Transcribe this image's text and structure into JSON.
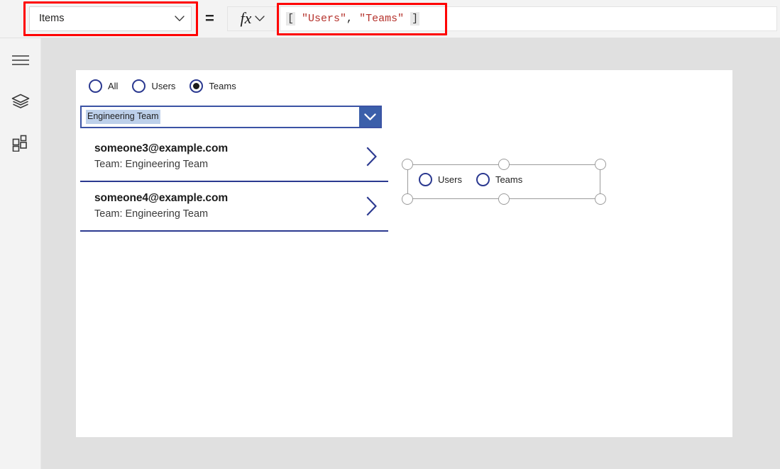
{
  "topbar": {
    "property_dropdown": {
      "value": "Items",
      "icon": "chevron-down-icon"
    },
    "equals": "=",
    "fx_button": {
      "glyph": "fx",
      "icon": "chevron-down-icon"
    },
    "formula": {
      "full_text": "[ \"Users\", \"Teams\" ]",
      "open_bracket": "[",
      "close_bracket": "]",
      "space_lead": " ",
      "space_trail": " ",
      "str_users": "\"Users\"",
      "comma": ", ",
      "str_teams": "\"Teams\""
    },
    "annotations": [
      {
        "name": "property-dropdown-highlight",
        "color": "#ff0000"
      },
      {
        "name": "formula-bar-highlight",
        "color": "#ff0000"
      }
    ]
  },
  "rail": {
    "items": [
      {
        "name": "hamburger-menu-icon",
        "label": "Menu"
      },
      {
        "name": "tree-view-icon",
        "label": "Tree view"
      },
      {
        "name": "insert-icon",
        "label": "Insert"
      }
    ]
  },
  "canvas": {
    "radio_group": {
      "name": "radio-group-filter",
      "options": [
        {
          "label": "All",
          "selected": false
        },
        {
          "label": "Users",
          "selected": false
        },
        {
          "label": "Teams",
          "selected": true
        }
      ]
    },
    "combobox": {
      "name": "team-combobox",
      "value": "Engineering Team",
      "icon": "chevron-down-icon"
    },
    "gallery": {
      "name": "member-gallery",
      "items": [
        {
          "title": "someone3@example.com",
          "subtitle": "Team: Engineering Team",
          "icon": "chevron-right-icon"
        },
        {
          "title": "someone4@example.com",
          "subtitle": "Team: Engineering Team",
          "icon": "chevron-right-icon"
        }
      ]
    },
    "selected_control": {
      "name": "radio-group-selected",
      "options": [
        {
          "label": "Users",
          "selected": false
        },
        {
          "label": "Teams",
          "selected": false
        }
      ],
      "handles": [
        "resize-handle-top-left",
        "resize-handle-top-middle",
        "resize-handle-top-right",
        "resize-handle-bottom-left",
        "resize-handle-bottom-middle",
        "resize-handle-bottom-right"
      ]
    }
  },
  "colors": {
    "accent_blue": "#2b3990",
    "combo_button": "#3b5faa",
    "selection_highlight": "#bdd0ea",
    "annotation_red": "#ff0000",
    "formula_string": "#b5322c",
    "workspace_bg": "#e0e0e0",
    "chrome_bg": "#f3f3f3"
  }
}
